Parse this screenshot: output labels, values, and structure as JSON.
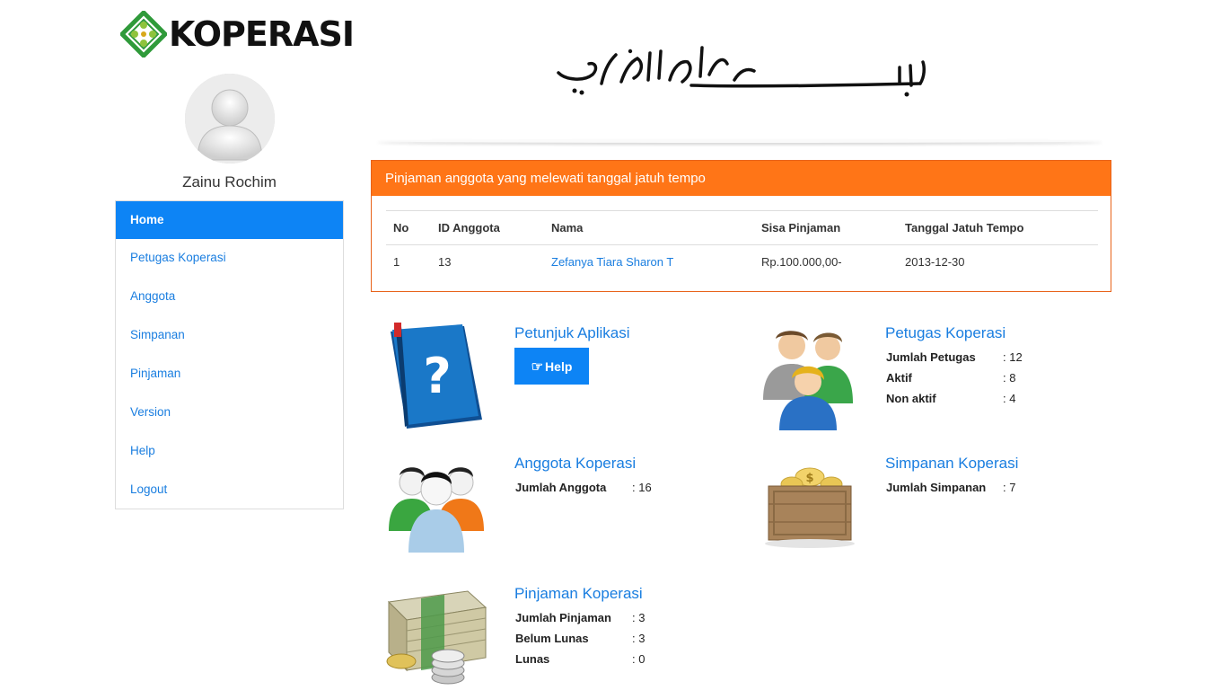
{
  "brand": {
    "name": "KOPERASI"
  },
  "user": {
    "name": "Zainu Rochim"
  },
  "sidebar": {
    "items": [
      {
        "label": "Home"
      },
      {
        "label": "Petugas Koperasi"
      },
      {
        "label": "Anggota"
      },
      {
        "label": "Simpanan"
      },
      {
        "label": "Pinjaman"
      },
      {
        "label": "Version"
      },
      {
        "label": "Help"
      },
      {
        "label": "Logout"
      }
    ]
  },
  "overdue": {
    "title": "Pinjaman anggota yang melewati tanggal jatuh tempo",
    "columns": [
      "No",
      "ID Anggota",
      "Nama",
      "Sisa Pinjaman",
      "Tanggal Jatuh Tempo"
    ],
    "rows": [
      {
        "no": "1",
        "id": "13",
        "nama": "Zefanya Tiara Sharon T",
        "sisa": "Rp.100.000,00-",
        "tanggal": "2013-12-30"
      }
    ]
  },
  "petunjuk": {
    "title": "Petunjuk Aplikasi",
    "button": "Help",
    "icon": "help-book-icon"
  },
  "petugas": {
    "title": "Petugas Koperasi",
    "icon": "staff-group-icon",
    "stats": [
      {
        "label": "Jumlah Petugas",
        "value": ": 12"
      },
      {
        "label": "Aktif",
        "value": ": 8"
      },
      {
        "label": "Non aktif",
        "value": ": 4"
      }
    ]
  },
  "anggota": {
    "title": "Anggota Koperasi",
    "icon": "members-icon",
    "stats": [
      {
        "label": "Jumlah Anggota",
        "value": ": 16"
      }
    ]
  },
  "simpanan": {
    "title": "Simpanan Koperasi",
    "icon": "treasure-chest-icon",
    "stats": [
      {
        "label": "Jumlah Simpanan",
        "value": ": 7"
      }
    ]
  },
  "pinjaman": {
    "title": "Pinjaman Koperasi",
    "icon": "money-stack-icon",
    "stats": [
      {
        "label": "Jumlah Pinjaman",
        "value": ": 3"
      },
      {
        "label": "Belum Lunas",
        "value": ": 3"
      },
      {
        "label": "Lunas",
        "value": ": 0"
      }
    ]
  },
  "colors": {
    "primary": "#0d84f5",
    "panel_header": "#ff7517",
    "link": "#1a7ee0"
  }
}
